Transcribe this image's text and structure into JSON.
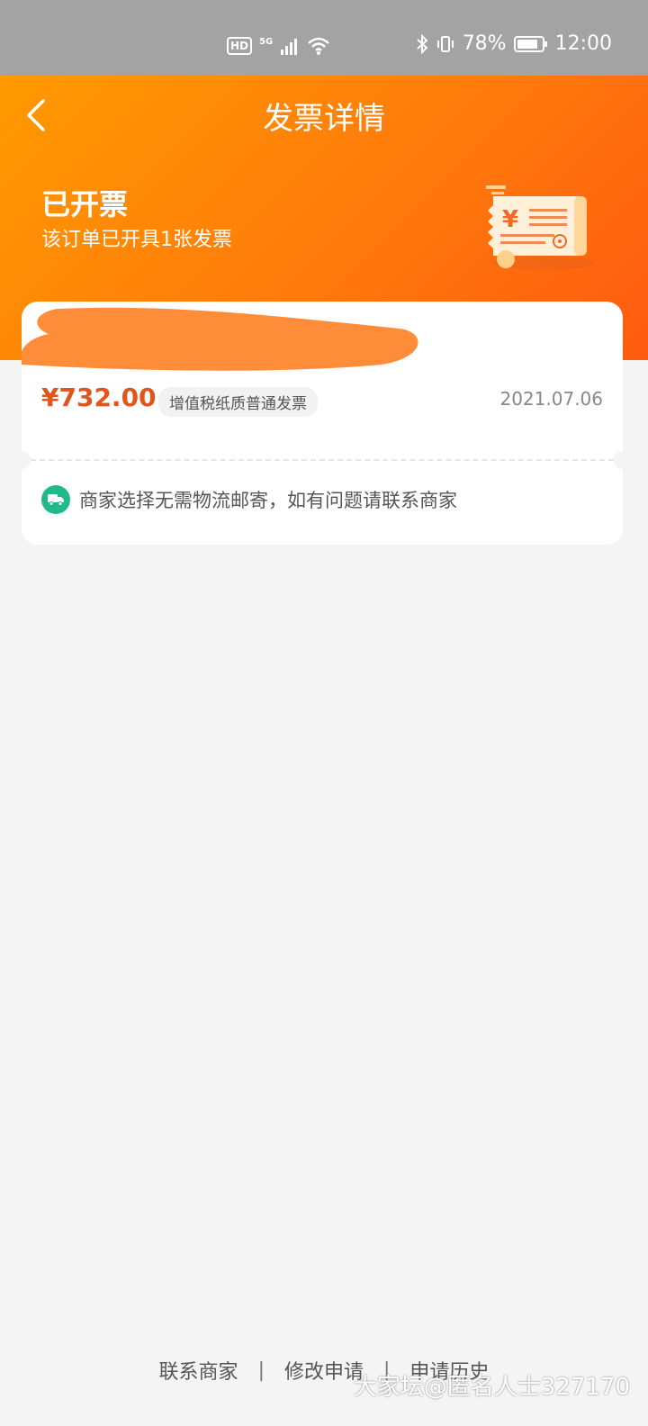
{
  "status_bar": {
    "hd": "HD",
    "network": "5G",
    "battery": "78%",
    "time": "12:00"
  },
  "header": {
    "title": "发票详情",
    "status_title": "已开票",
    "status_subtitle": "该订单已开具1张发票"
  },
  "invoice": {
    "amount": "¥732.00",
    "type": "增值税纸质普通发票",
    "date": "2021.07.06",
    "notice": "商家选择无需物流邮寄，如有问题请联系商家"
  },
  "footer": {
    "contact_label": "联系商家",
    "modify_label": "修改申请",
    "history_label": "申请历史",
    "separator": "|"
  },
  "watermark": "大家坛@匿名人士327170",
  "colors": {
    "accent": "#ff7a0c",
    "amount": "#e2551a",
    "notice_icon": "#1fb98b"
  }
}
